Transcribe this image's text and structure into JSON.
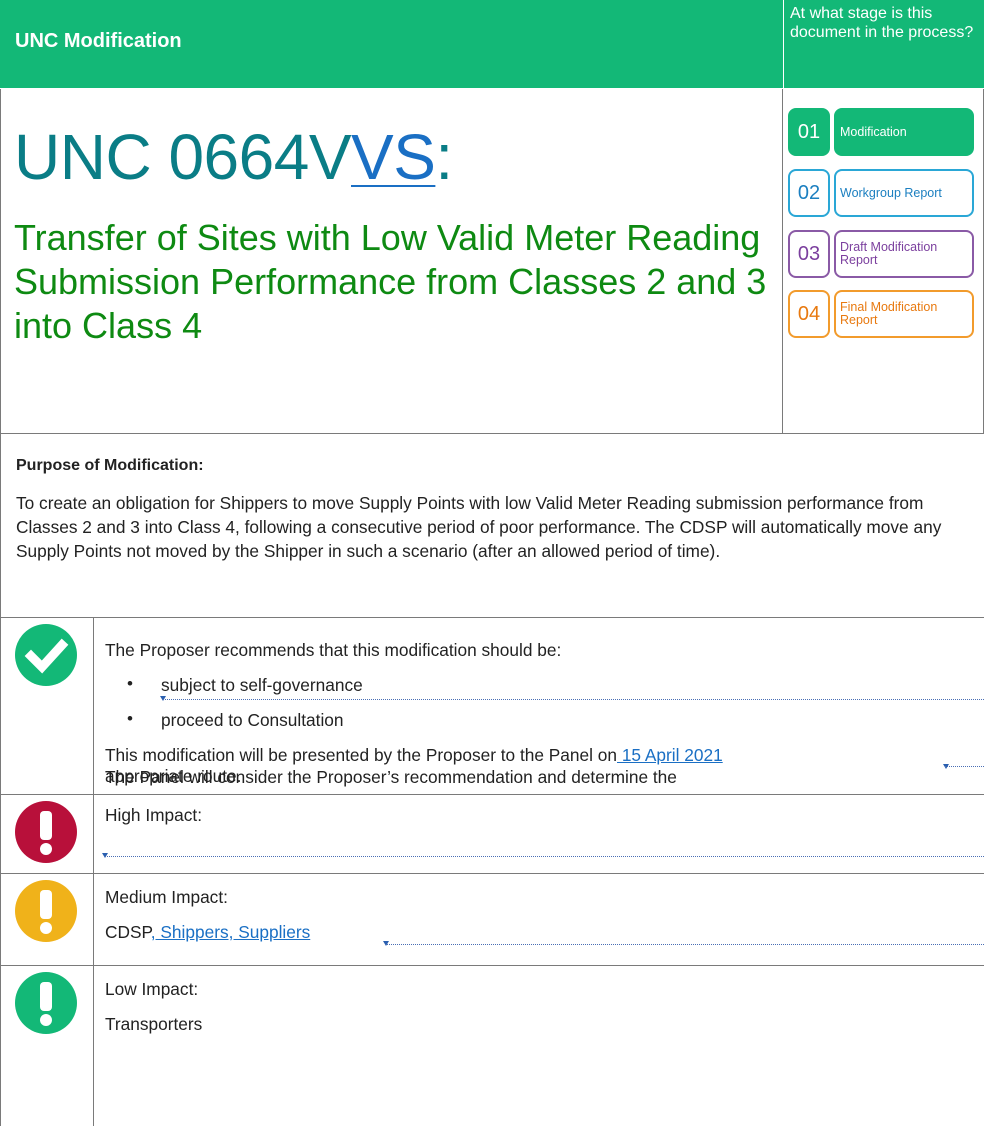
{
  "header": {
    "title": "UNC Modification",
    "stage_question": "At what stage is this document in the process?"
  },
  "modification": {
    "number_prefix": "UNC 0664V",
    "number_vs": "VS",
    "number_suffix": ":",
    "title": "Transfer of Sites with Low Valid Meter Reading Submission Performance from Classes 2 and 3 into Class 4"
  },
  "stages": [
    {
      "num": "01",
      "label": "Modification"
    },
    {
      "num": "02",
      "label": "Workgroup Report"
    },
    {
      "num": "03",
      "label": "Draft Modification Report"
    },
    {
      "num": "04",
      "label": "Final Modification Report"
    }
  ],
  "purpose": {
    "heading": "Purpose of Modification:",
    "text": "To create an obligation for Shippers to move Supply Points with low Valid Meter Reading submission performance from Classes 2 and 3 into Class 4, following a consecutive period of poor performance. The CDSP will automatically move any Supply Points not moved by the Shipper in such a scenario (after an allowed period of time)."
  },
  "recommendation": {
    "intro": "The Proposer recommends that this modification should be:",
    "bullets": [
      "subject to self-governance",
      "proceed to Consultation"
    ],
    "presented_prefix": "This modification will be presented by the Proposer to the Panel on",
    "date": " 15 April 2021",
    "line2": "The Panel will consider the Proposer’s recommendation and determine the",
    "line3": "appropriate route."
  },
  "impacts": {
    "high": {
      "label": "High Impact:",
      "value": ""
    },
    "medium": {
      "label": "Medium Impact:",
      "value_prefix": "CDSP",
      "value_link": ", Shippers, Suppliers"
    },
    "low": {
      "label": "Low Impact:",
      "value": "Transporters"
    }
  },
  "colors": {
    "brand_green": "#13b877",
    "title_teal": "#0a7d86",
    "title_green": "#0e8a12",
    "link_blue": "#1a6fc4",
    "high_red": "#b8103a",
    "medium_amber": "#f0b21a",
    "low_green": "#13b877"
  },
  "icons": [
    "check-circle-icon",
    "exclamation-red-icon",
    "exclamation-amber-icon",
    "exclamation-green-icon"
  ]
}
